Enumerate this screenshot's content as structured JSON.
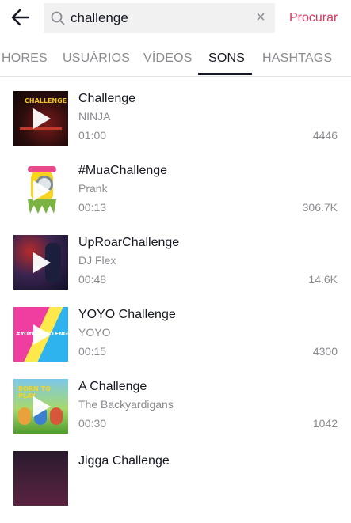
{
  "search": {
    "query": "challenge",
    "submit_label": "Procurar",
    "icons": [
      "back-arrow-icon",
      "search-icon",
      "clear-icon"
    ]
  },
  "tabs": [
    {
      "label": "HORES",
      "active": false
    },
    {
      "label": "USUÁRIOS",
      "active": false
    },
    {
      "label": "VÍDEOS",
      "active": false
    },
    {
      "label": "SONS",
      "active": true
    },
    {
      "label": "HASHTAGS",
      "active": false
    }
  ],
  "sounds": [
    {
      "title": "Challenge",
      "artist": "NINJA",
      "duration": "01:00",
      "count": "4446",
      "cover_text": "CHALLENGE"
    },
    {
      "title": "#MuaChallenge",
      "artist": "Prank",
      "duration": "00:13",
      "count": "306.7K"
    },
    {
      "title": "UpRoarChallenge",
      "artist": "DJ Flex",
      "duration": "00:48",
      "count": "14.6K"
    },
    {
      "title": "YOYO Challenge",
      "artist": "YOYO",
      "duration": "00:15",
      "count": "4300",
      "cover_text": "#YOYOCHALLENGE"
    },
    {
      "title": "A Challenge",
      "artist": "The Backyardigans",
      "duration": "00:30",
      "count": "1042",
      "cover_text": "BORN TO PLAY"
    },
    {
      "title": "Jigga Challenge",
      "artist": "",
      "duration": "",
      "count": ""
    }
  ],
  "colors": {
    "accent": "#d1395e",
    "text": "#161823",
    "muted": "#8a8b91",
    "search_bg": "#f1f1f2"
  }
}
